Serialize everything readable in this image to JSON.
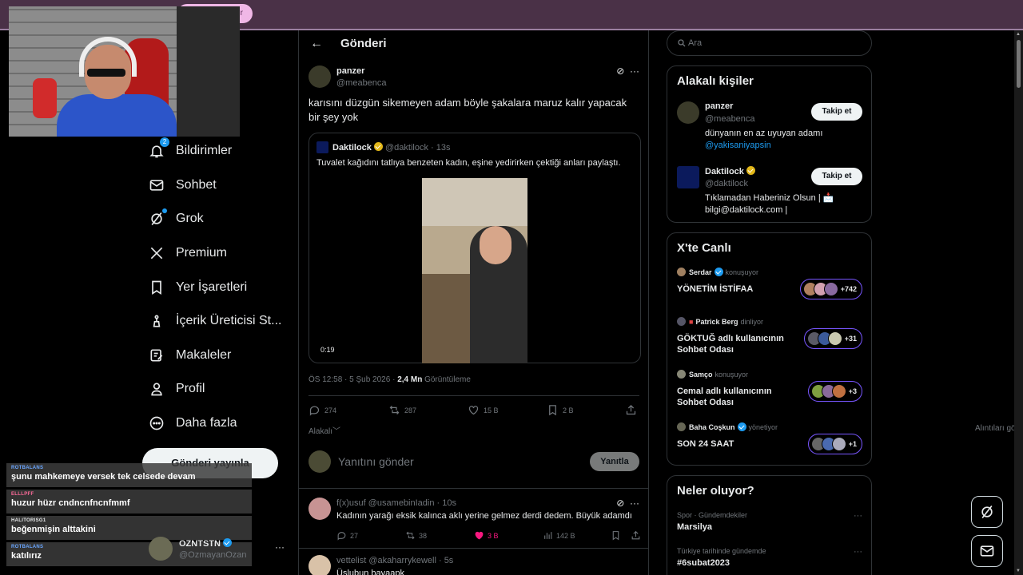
{
  "stream": {
    "top_pill_label": "r"
  },
  "nav": {
    "notifications_badge": "2",
    "items": [
      {
        "label": "Bildirimler",
        "icon": "bell-icon"
      },
      {
        "label": "Sohbet",
        "icon": "mail-icon"
      },
      {
        "label": "Grok",
        "icon": "grok-icon"
      },
      {
        "label": "Premium",
        "icon": "x-logo-icon"
      },
      {
        "label": "Yer İşaretleri",
        "icon": "bookmark-icon"
      },
      {
        "label": "İçerik Üreticisi St...",
        "icon": "creator-studio-icon"
      },
      {
        "label": "Makaleler",
        "icon": "articles-icon"
      },
      {
        "label": "Profil",
        "icon": "person-icon"
      },
      {
        "label": "Daha fazla",
        "icon": "more-circle-icon"
      }
    ],
    "post_button": "Gönderi yayınla"
  },
  "chat": [
    {
      "user": "ROTBALANS",
      "text": "şunu mahkemeye versek tek celsede devam",
      "color": "#6aa6ff"
    },
    {
      "user": "ELLLPFF",
      "text": "huzur hüzr cndncnfncnfmmf",
      "color": "#ff6b9a"
    },
    {
      "user": "HALITORISG1",
      "text": "beğenmişin alttakini",
      "color": "#e7e9ea"
    },
    {
      "user": "ROTBALANS",
      "text": "katılırız",
      "color": "#6aa6ff"
    }
  ],
  "account": {
    "name": "OZNTSTN",
    "handle": "@OzmayanOzan",
    "more": "···"
  },
  "header": {
    "back_icon": "arrow-left-icon",
    "title": "Gönderi"
  },
  "post": {
    "name": "panzer",
    "handle": "@meabenca",
    "text": "karısını düzgün sikemeyen adam böyle şakalara maruz kalır yapacak bir şey yok",
    "quote": {
      "name": "Daktilock",
      "handle": "@daktilock",
      "time": "13s",
      "text": "Tuvalet kağıdını tatlıya benzeten kadın, eşine yedirirken çektiği anları paylaştı.",
      "video_time": "0:19"
    },
    "meta_time": "ÖS 12:58 · 5 Şub 2026 · ",
    "views_count": "2,4 Mn",
    "views_label": " Görüntüleme",
    "stats": {
      "replies": "274",
      "reposts": "287",
      "likes": "15 B",
      "bookmarks": "2 B"
    },
    "sort_label": "Alakalı",
    "quotes_label": "Alıntıları görüntüle"
  },
  "reply_box": {
    "placeholder": "Yanıtını gönder",
    "button": "Yanıtla"
  },
  "replies": [
    {
      "name": "f(x)usuf",
      "handle": "@usamebinIadin",
      "time": "10s",
      "text": "Kadının yarağı eksik kalınca aklı yerine gelmez derdi dedem. Büyük adamdı",
      "stats": {
        "replies": "27",
        "reposts": "38",
        "likes": "3 B",
        "views": "142 B"
      }
    },
    {
      "name": "vettelist",
      "handle": "@akaharrykewell",
      "time": "5s",
      "text": "Üslubun bayaapk"
    }
  ],
  "sidebar": {
    "search_placeholder": "Ara",
    "relevant_title": "Alakalı kişiler",
    "follow_label": "Takip et",
    "people": [
      {
        "name": "panzer",
        "handle": "@meabenca",
        "bio": "dünyanın en az uyuyan adamı ",
        "bio_link": "@yakisaniyapsin"
      },
      {
        "name": "Daktilock",
        "handle": "@daktilock",
        "bio": "Tıklamadan Haberiniz Olsun | 📩 bilgi@daktilock.com |",
        "bio_link": ""
      }
    ],
    "live_title": "X'te Canlı",
    "spaces": [
      {
        "host": "Serdar",
        "activity": "konuşuyor",
        "title": "YÖNETİM İSTİFAA",
        "count": "+742"
      },
      {
        "host": "Patrick Berg",
        "activity": "dinliyor",
        "title": "GÖKTUĞ adlı kullanıcının Sohbet Odası",
        "count": "+31"
      },
      {
        "host": "Samço",
        "activity": "konuşuyor",
        "title": "Cemal adlı kullanıcının Sohbet Odası",
        "count": "+3"
      },
      {
        "host": "Baha Coşkun",
        "activity": "yönetiyor",
        "title": "SON 24 SAAT",
        "count": "+1"
      }
    ],
    "trends_title": "Neler oluyor?",
    "trends": [
      {
        "context": "Spor · Gündemdekiler",
        "topic": "Marsilya"
      },
      {
        "context": "Türkiye tarihinde gündemde",
        "topic": "#6subat2023"
      }
    ]
  },
  "colors": {
    "accent": "#1d9bf0",
    "live_ring": "#7856ff",
    "like_active": "#f91880",
    "stream_bar": "#4a3147"
  }
}
